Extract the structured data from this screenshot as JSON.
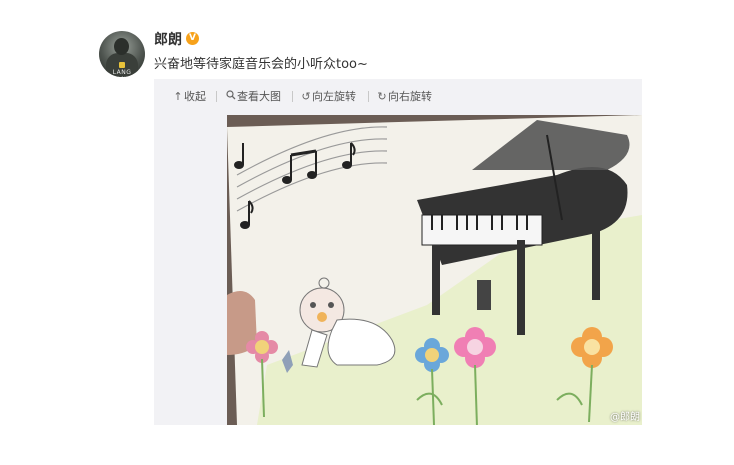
{
  "post": {
    "username": "郎朗",
    "verified_badge": "V",
    "text": "兴奋地等待家庭音乐会的小听众too~"
  },
  "avatar": {
    "caption": "LANG LANG"
  },
  "toolbar": {
    "collapse": "收起",
    "view_large": "查看大图",
    "rotate_left": "向左旋转",
    "rotate_right": "向右旋转"
  },
  "icons": {
    "collapse": "arrow-up-icon",
    "view_large": "magnifier-icon",
    "rotate_left": "rotate-left-icon",
    "rotate_right": "rotate-right-icon"
  },
  "image": {
    "watermark": "@郎朗"
  },
  "colors": {
    "text": "#333333",
    "badge": "#f7a21b",
    "toolbar_bg": "#f2f2f5"
  }
}
